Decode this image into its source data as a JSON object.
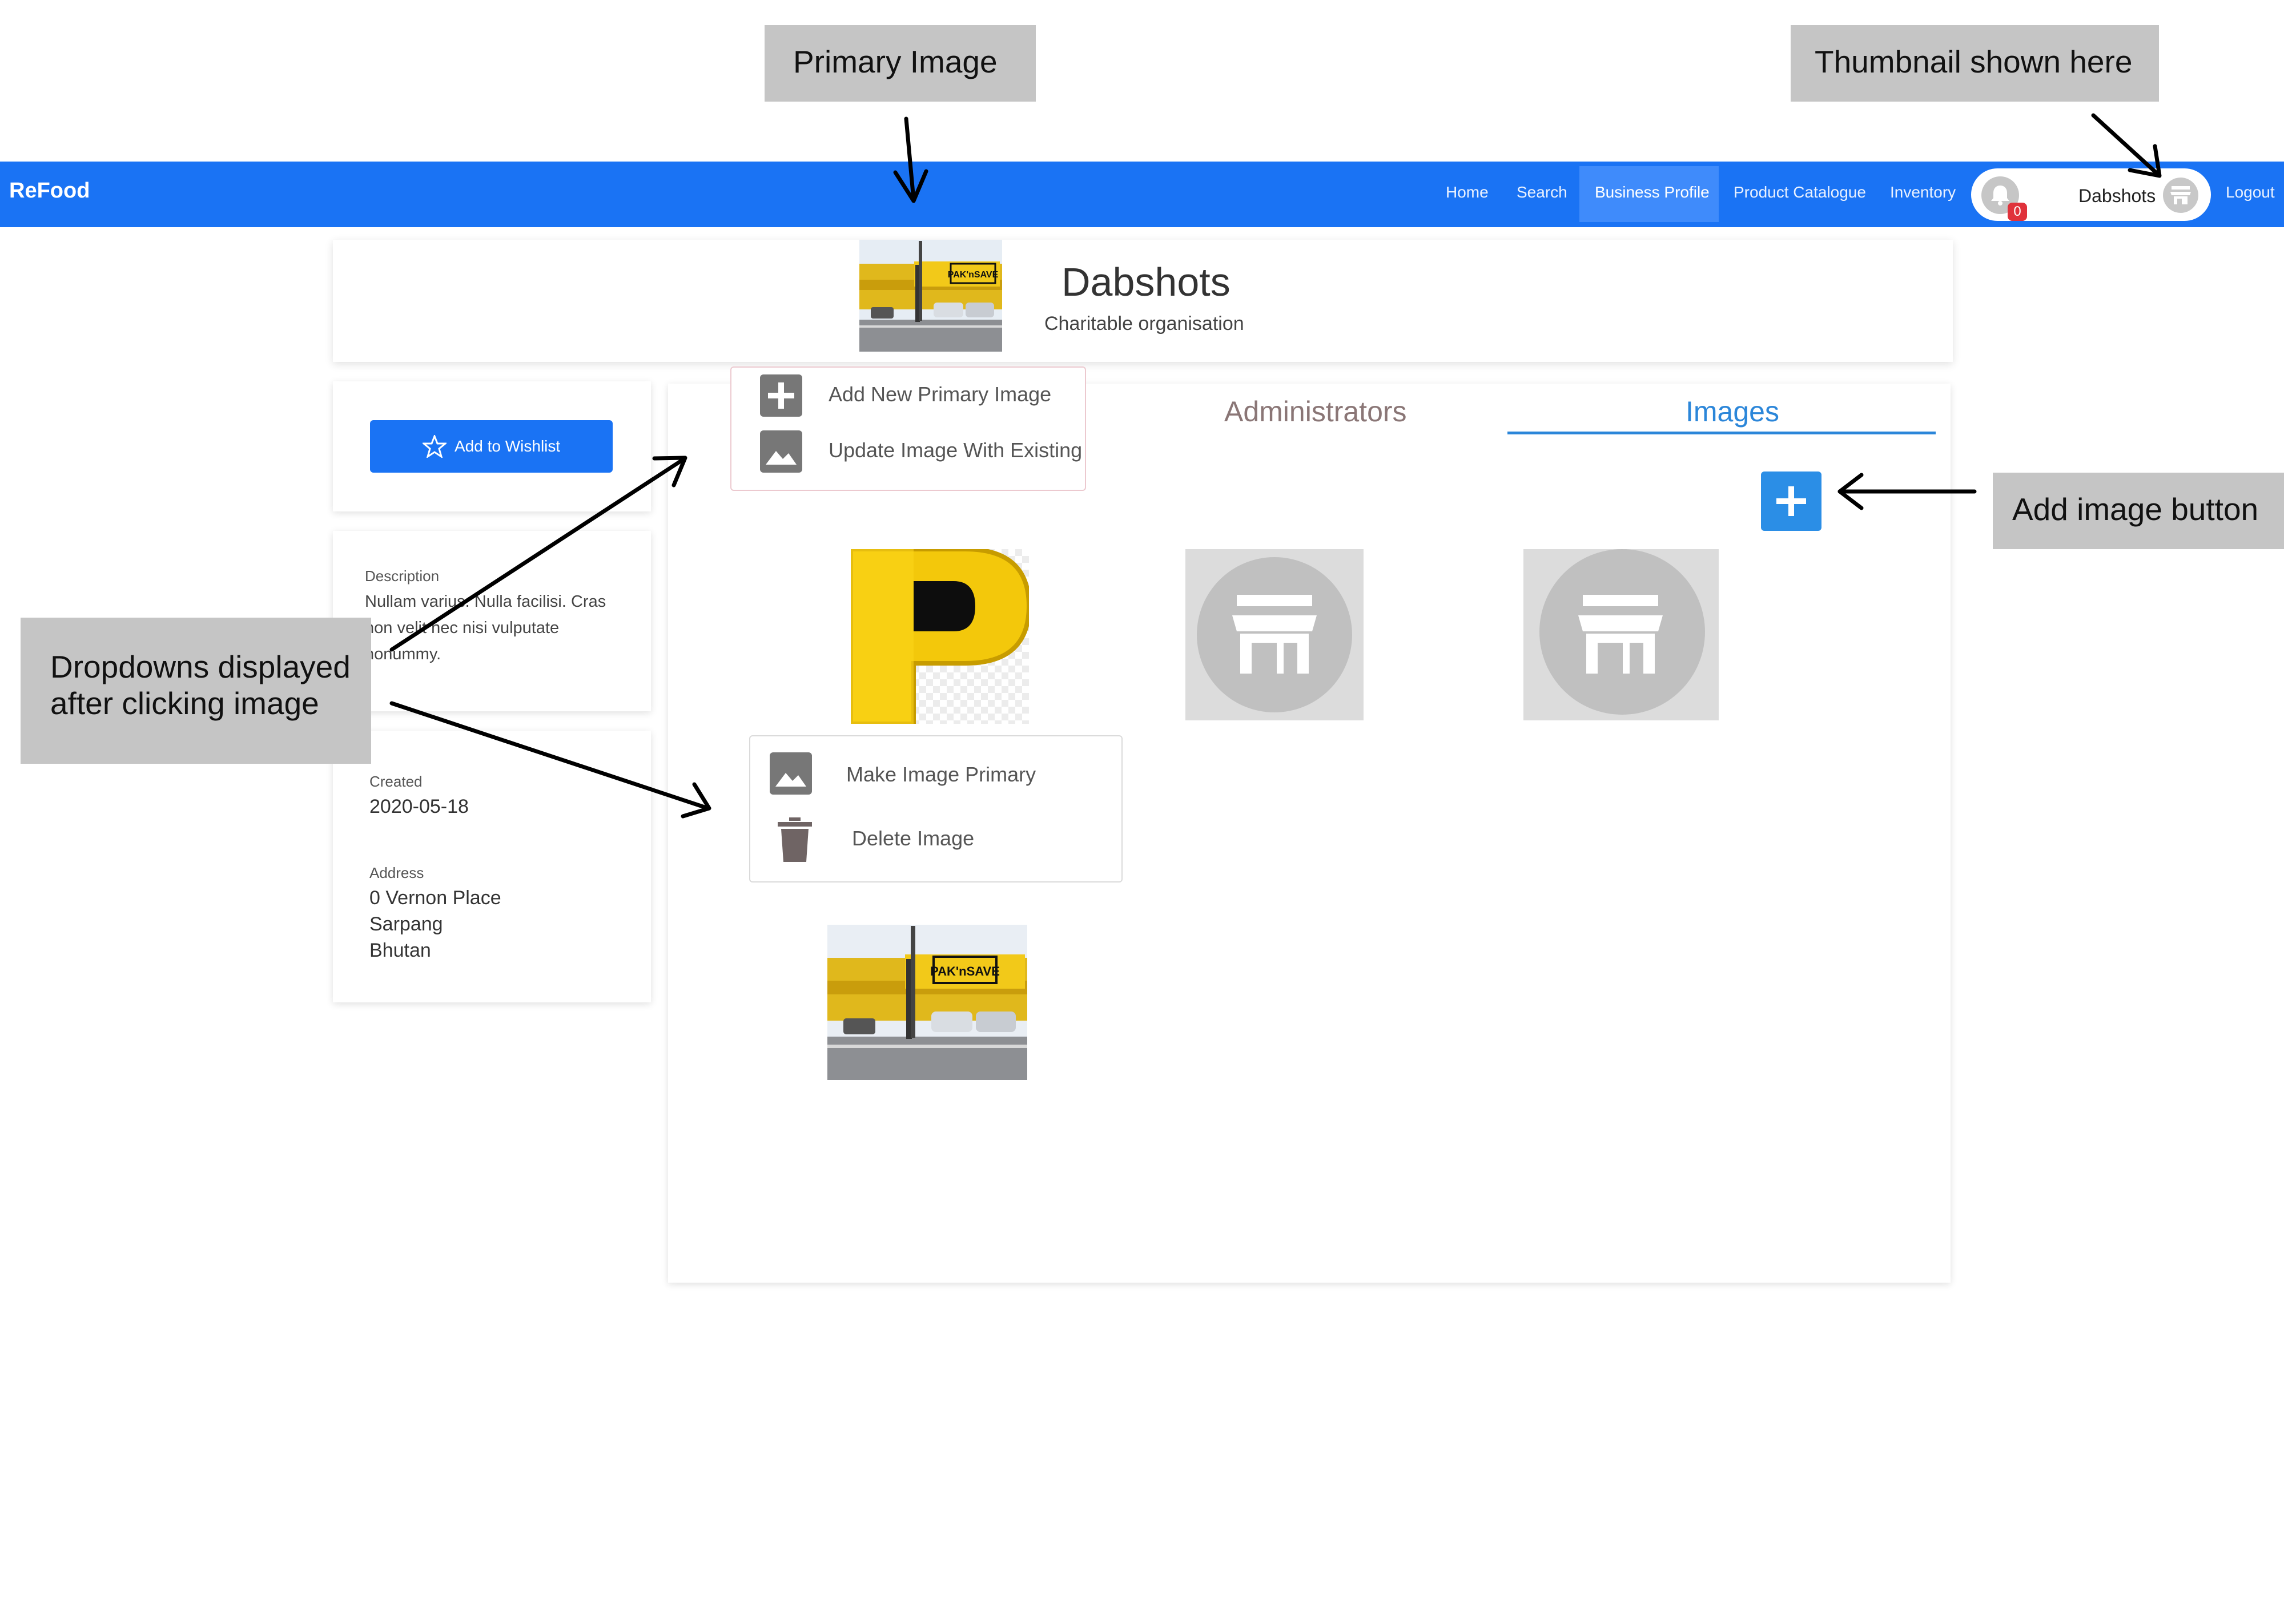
{
  "annotations": {
    "primary_image": "Primary Image",
    "thumbnail": "Thumbnail shown here",
    "add_image_button": "Add image button",
    "dropdowns_line1": "Dropdowns displayed",
    "dropdowns_line2": "after clicking image"
  },
  "navbar": {
    "brand": "ReFood",
    "links": [
      "Home",
      "Search",
      "Business Profile",
      "Product Catalogue",
      "Inventory"
    ],
    "active_link": "Business Profile",
    "notification_count": "0",
    "user_name": "Dabshots",
    "logout": "Logout"
  },
  "header": {
    "business_name": "Dabshots",
    "business_type": "Charitable organisation"
  },
  "sidebar": {
    "wishlist_button": "Add to Wishlist",
    "description_label": "Description",
    "description_lines": [
      "Nullam varius. Nulla facilisi. Cras",
      "non velit nec nisi vulputate",
      "nonummy."
    ],
    "created_label": "Created",
    "created_value": "2020-05-18",
    "address_label": "Address",
    "address_lines": [
      "0 Vernon Place",
      "Sarpang",
      "Bhutan"
    ]
  },
  "tabs": {
    "administrators": "Administrators",
    "images": "Images",
    "active": "Images"
  },
  "dropdown_primary": {
    "items": [
      "Add New Primary Image",
      "Update Image With Existing"
    ]
  },
  "dropdown_image": {
    "items": [
      "Make Image Primary",
      "Delete Image"
    ]
  },
  "storefront_sign": "PAK'nSAVE",
  "colors": {
    "navbar": "#1a73f4",
    "active_tab": "#2b86d9",
    "add_button": "#2b8ee6",
    "badge": "#e0323b"
  }
}
